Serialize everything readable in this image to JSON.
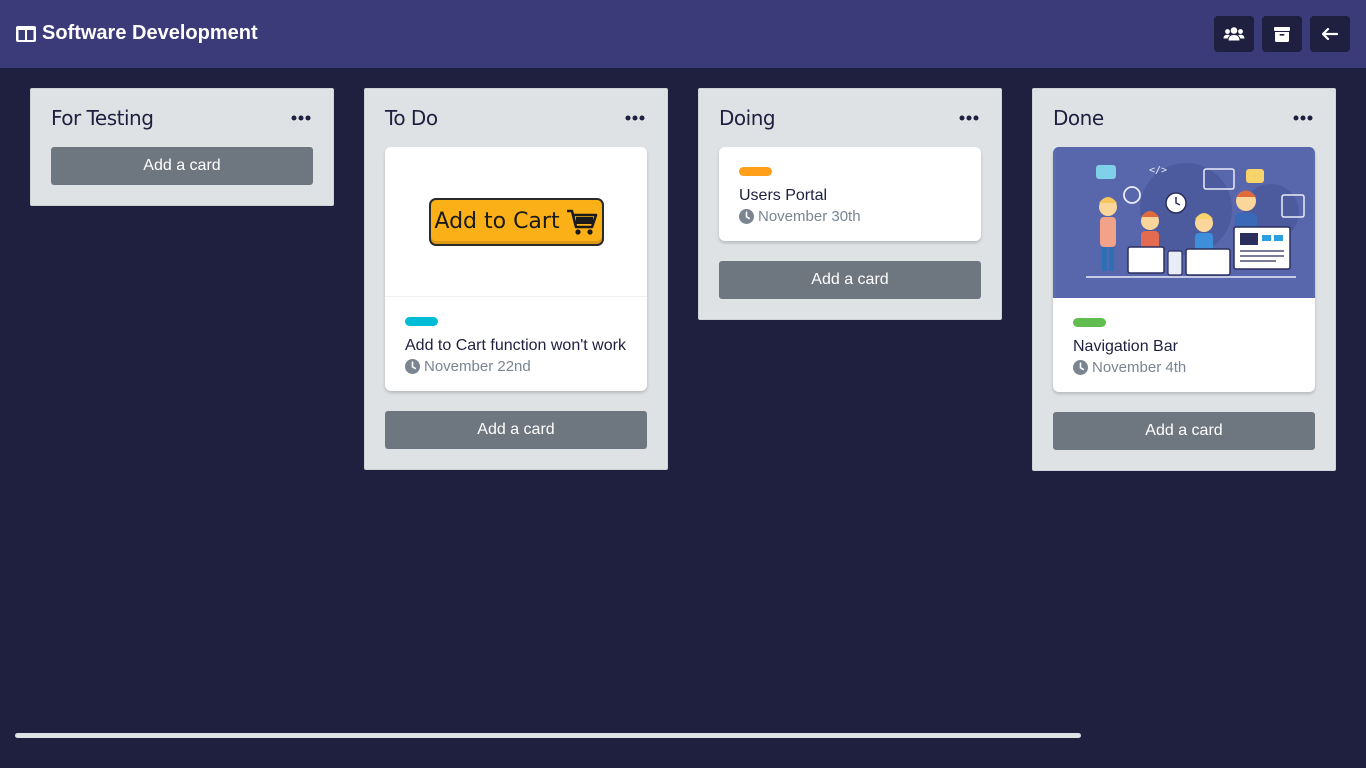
{
  "header": {
    "board_title": "Software Development",
    "actions": [
      {
        "icon": "users-icon",
        "name": "members-button"
      },
      {
        "icon": "archive-icon",
        "name": "archive-button"
      },
      {
        "icon": "arrow-left-icon",
        "name": "back-button"
      }
    ]
  },
  "lists": [
    {
      "title": "For Testing",
      "add_label": "Add a card",
      "cards": []
    },
    {
      "title": "To Do",
      "add_label": "Add a card",
      "cards": [
        {
          "cover": "add-to-cart-image",
          "cover_text": "Add to Cart",
          "label_color": "#00bcd4",
          "title": "Add to Cart function won't work",
          "due": "November 22nd"
        }
      ]
    },
    {
      "title": "Doing",
      "add_label": "Add a card",
      "cards": [
        {
          "label_color": "#ff9f1a",
          "title": "Users Portal",
          "due": "November 30th"
        }
      ]
    },
    {
      "title": "Done",
      "add_label": "Add a card",
      "cards": [
        {
          "cover": "developers-illustration",
          "label_color": "#61bd4f",
          "title": "Navigation Bar",
          "due": "November 4th"
        }
      ]
    }
  ],
  "colors": {
    "background": "#1f1f3f",
    "topbar": "#3a3b78",
    "list_bg": "#dfe2e5",
    "add_button": "#6e7680"
  }
}
